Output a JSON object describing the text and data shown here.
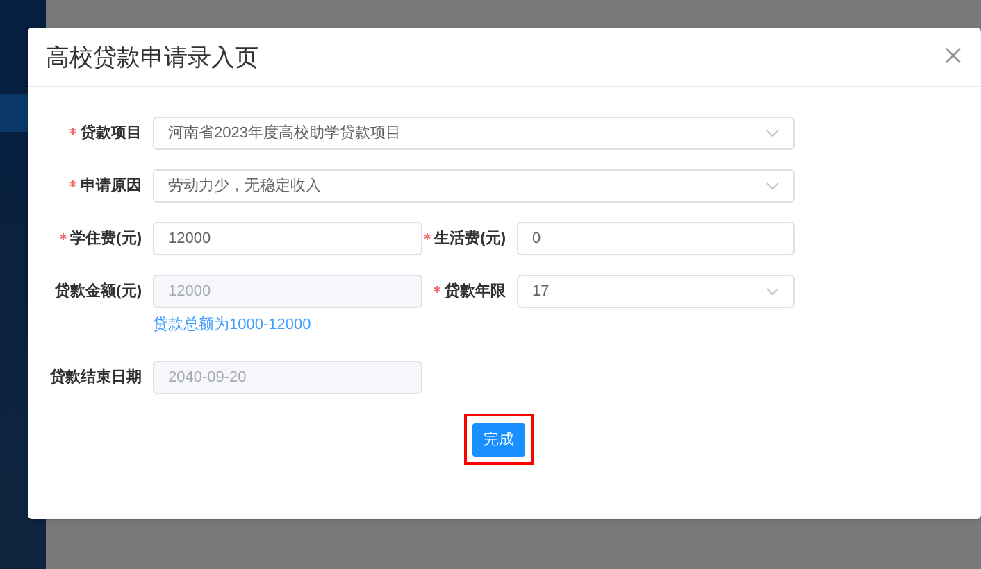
{
  "dialog": {
    "title": "高校贷款申请录入页",
    "rows": [
      [
        {
          "label": "贷款项目",
          "required": true,
          "kind": "select",
          "value": "河南省2023年度高校助学贷款项目"
        }
      ],
      [
        {
          "label": "申请原因",
          "required": true,
          "kind": "select",
          "value": "劳动力少，无稳定收入"
        }
      ],
      [
        {
          "label": "学住费(元)",
          "required": true,
          "kind": "input",
          "value": "12000"
        },
        {
          "label": "生活费(元)",
          "required": true,
          "kind": "input",
          "value": "0"
        }
      ],
      [
        {
          "label": "贷款金额(元)",
          "required": false,
          "kind": "disabled",
          "value": "12000",
          "help": "贷款总额为1000-12000"
        },
        {
          "label": "贷款年限",
          "required": true,
          "kind": "select",
          "value": "17"
        }
      ],
      [
        {
          "label": "贷款结束日期",
          "required": false,
          "kind": "disabled",
          "value": "2040-09-20"
        }
      ]
    ],
    "button": {
      "label": "完成",
      "highlighted": true
    }
  }
}
